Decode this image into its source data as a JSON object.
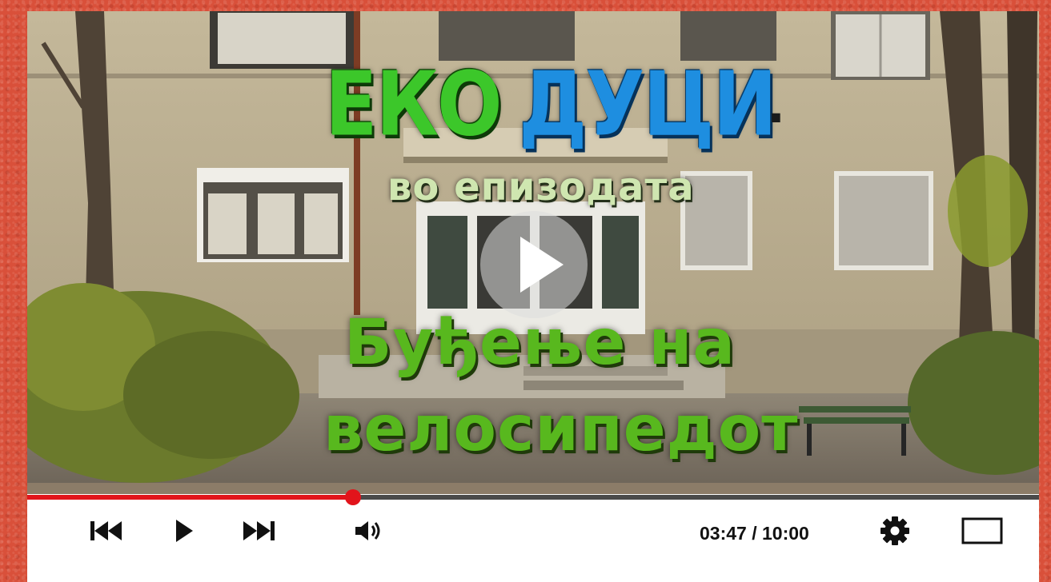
{
  "video": {
    "title_word_1": "ЕКО",
    "title_word_2": "ДУЦИ",
    "title_dot": ".",
    "subtitle": "во епизодата",
    "episode_line_1": "Буђење на",
    "episode_line_2": "велосипедот"
  },
  "player": {
    "progress_fraction": 0.322,
    "buffer_fraction": 1.0,
    "time_current": "03:47",
    "time_separator": " / ",
    "time_total": "10:00"
  },
  "icons": {
    "big_play": "play-icon",
    "skip_back": "skip-back-icon",
    "play": "play-icon",
    "skip_forward": "skip-forward-icon",
    "volume": "volume-icon",
    "settings": "gear-icon",
    "fullscreen": "fullscreen-icon"
  },
  "colors": {
    "page_background": "#d9503a",
    "progress_played": "#e2141b",
    "progress_unplayed": "#4a4a4a",
    "title_green": "#3cc72a",
    "title_blue": "#1e8ee0",
    "episode_green": "#58b81e"
  }
}
